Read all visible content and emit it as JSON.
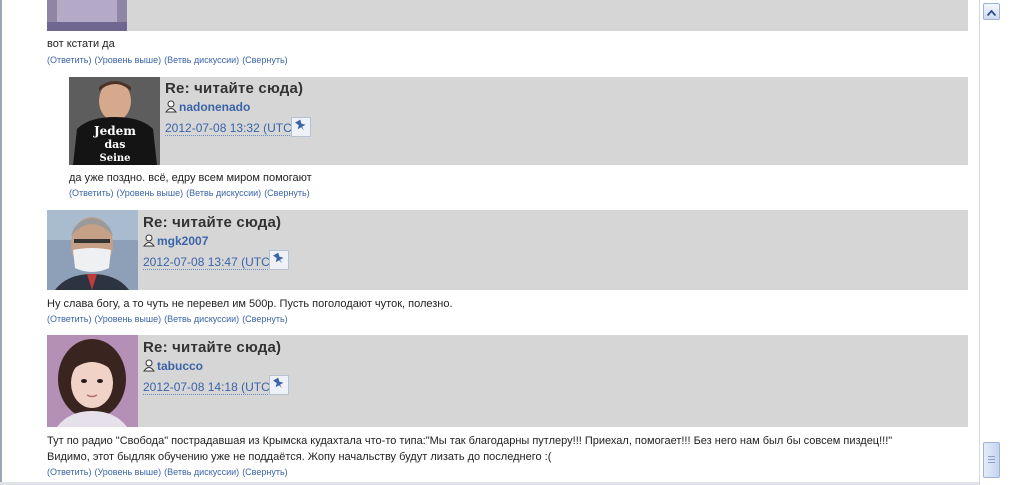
{
  "comments": [
    {
      "text": "вот кстати да",
      "links": [
        "(Ответить)",
        "(Уровень выше)",
        "(Ветвь дискуссии)",
        "(Свернуть)"
      ]
    },
    {
      "title": "Re: читайте сюда)",
      "username": "nadonenado",
      "date": "2012-07-08 13:32 (UTC)",
      "avatar_text": [
        "Jedem",
        "das",
        "Seine"
      ],
      "text": "да уже поздно. всё, едру всем миром помогают",
      "links": [
        "(Ответить)",
        "(Уровень выше)",
        "(Ветвь дискуссии)",
        "(Свернуть)"
      ]
    },
    {
      "title": "Re: читайте сюда)",
      "username": "mgk2007",
      "date": "2012-07-08 13:47 (UTC)",
      "text": "Ну слава богу, а то чуть не перевел им 500р. Пусть поголодают чуток, полезно.",
      "links": [
        "(Ответить)",
        "(Уровень выше)",
        "(Ветвь дискуссии)",
        "(Свернуть)"
      ]
    },
    {
      "title": "Re: читайте сюда)",
      "username": "tabucco",
      "date": "2012-07-08 14:18 (UTC)",
      "text_lines": [
        "Тут по радио \"Свобода\" пострадавшая из Крымска кудахтала что-то типа:\"Мы так благодарны путлеру!!! Приехал, помогает!!! Без него нам был бы совсем пиздец!!!\"",
        "Видимо, этот быдляк обучению уже не поддаётся. Жопу начальству будут лизать до последнего :("
      ],
      "links": [
        "(Ответить)",
        "(Уровень выше)",
        "(Ветвь дискуссии)",
        "(Свернуть)"
      ]
    }
  ],
  "icons": {
    "user": "user-icon",
    "link": "pushpin-link-icon",
    "scroll_up": "arrow-up-icon"
  },
  "colors": {
    "comment_header_bg": "#d6d6d6",
    "link": "#3b64a8"
  }
}
